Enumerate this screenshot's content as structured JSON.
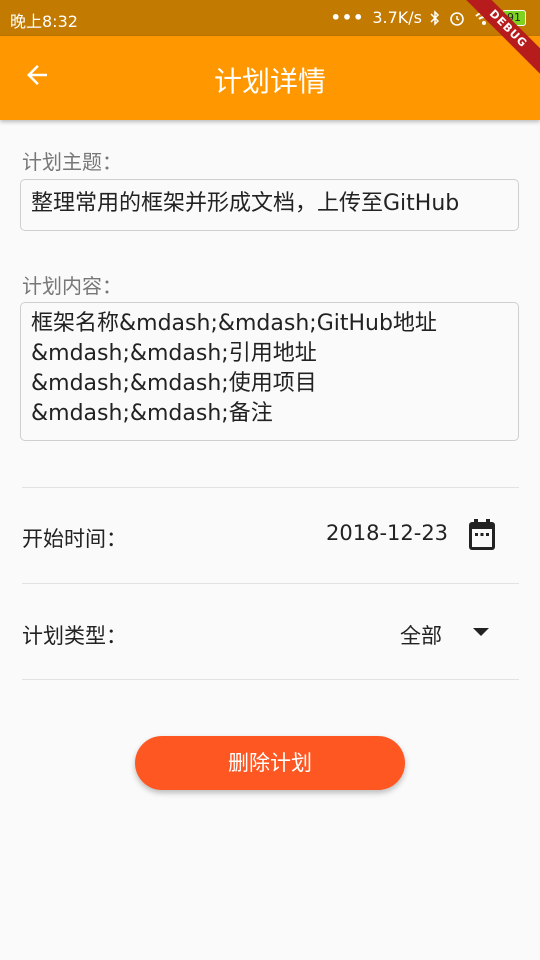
{
  "status_bar": {
    "time": "晚上8:32",
    "network_speed": "3.7K/s",
    "battery": "91",
    "icons": [
      "dots-icon",
      "bluetooth-icon",
      "alarm-icon",
      "wifi-icon",
      "battery-icon"
    ]
  },
  "app_bar": {
    "title": "计划详情",
    "back_icon": "arrow-back-icon",
    "debug_label": "DEBUG"
  },
  "form": {
    "topic_label": "计划主题：",
    "topic_value": "整理常用的框架并形成文档，上传至GitHub",
    "content_label": "计划内容：",
    "content_value": "框架名称&mdash;&mdash;GitHub地址\n&mdash;&mdash;引用地址\n&mdash;&mdash;使用项目\n&mdash;&mdash;备注",
    "start_time_label": "开始时间：",
    "start_time_value": "2018-12-23",
    "type_label": "计划类型：",
    "type_value": "全部"
  },
  "delete_button": {
    "label": "删除计划"
  },
  "colors": {
    "app_bar": "#ff9800",
    "status_bar": "#c27a00",
    "delete_button": "#ff5722"
  }
}
